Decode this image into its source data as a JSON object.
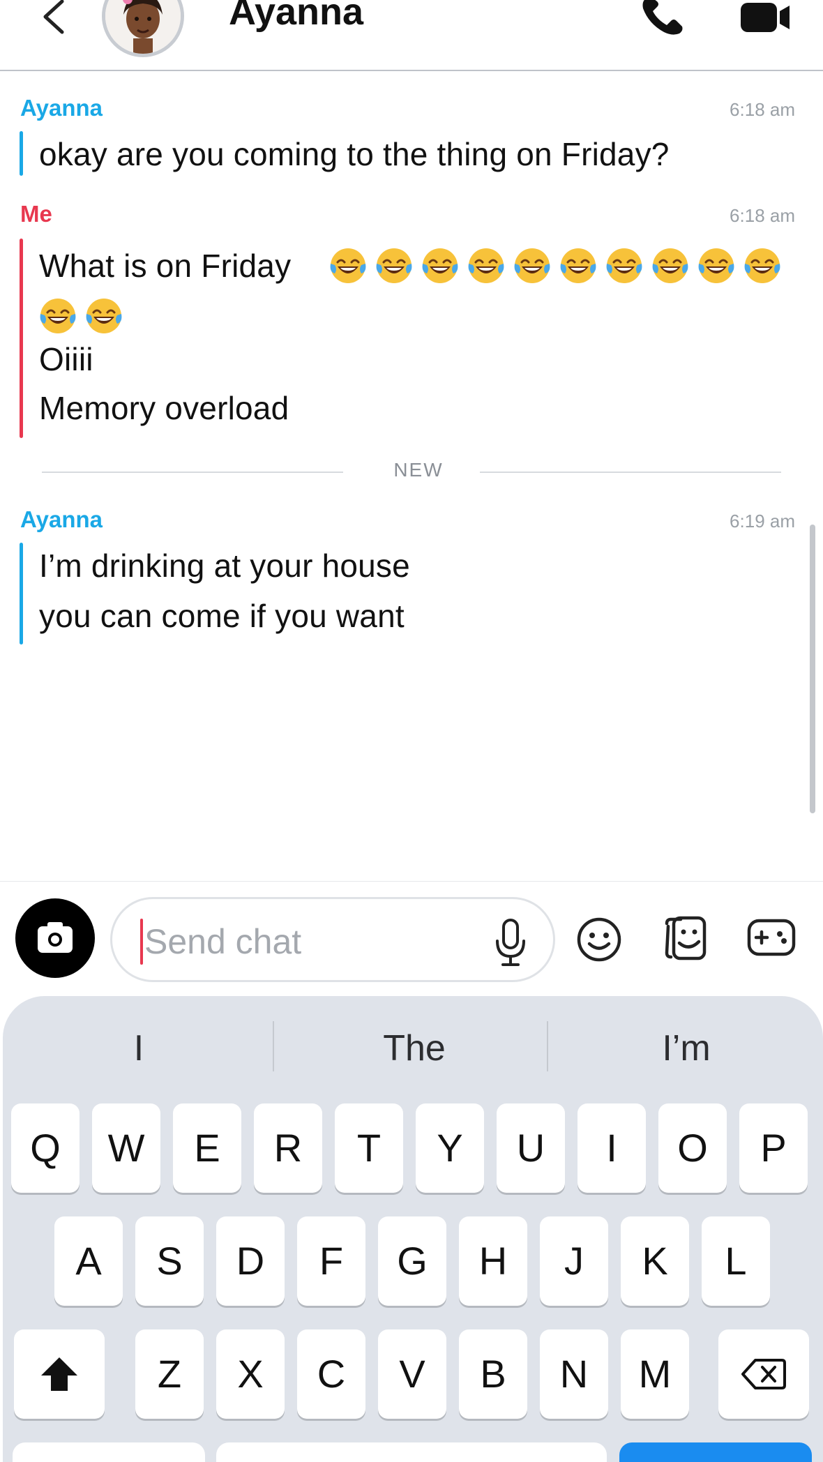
{
  "header": {
    "contact_name": "Ayanna"
  },
  "messages": [
    {
      "sender": "Ayanna",
      "time": "6:18 am",
      "lines": [
        "okay are you coming to the thing on Friday?"
      ]
    },
    {
      "sender": "Me",
      "time": "6:18 am",
      "first_line": "What is on Friday",
      "emoji_count": 12,
      "lines": [
        "Oiiii",
        "Memory overload"
      ]
    },
    {
      "sender": "Ayanna",
      "time": "6:19 am",
      "lines": [
        "I’m drinking at your house",
        "you can come if you want"
      ]
    }
  ],
  "divider": {
    "label": "NEW"
  },
  "composer": {
    "placeholder": "Send chat"
  },
  "keyboard": {
    "suggestions": [
      "I",
      "The",
      "I’m"
    ],
    "row1": [
      "Q",
      "W",
      "E",
      "R",
      "T",
      "Y",
      "U",
      "I",
      "O",
      "P"
    ],
    "row2": [
      "A",
      "S",
      "D",
      "F",
      "G",
      "H",
      "J",
      "K",
      "L"
    ],
    "row3": [
      "Z",
      "X",
      "C",
      "V",
      "B",
      "N",
      "M"
    ]
  },
  "colors": {
    "them": "#1aa8e6",
    "me": "#e8384f",
    "send_blue": "#1a8cf0"
  }
}
